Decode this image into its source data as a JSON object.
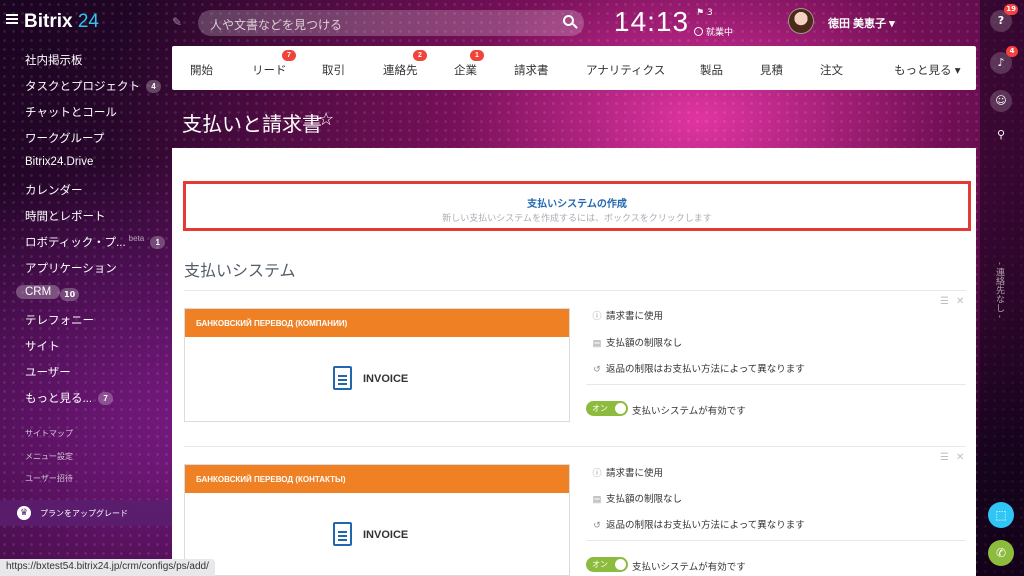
{
  "header": {
    "logo_name": "Bitrix",
    "logo_num": "24",
    "search_placeholder": "人や文書などを見つける",
    "clock": "14:13",
    "flag_count": "3",
    "work_status": "就業中",
    "user_name": "徳田 美恵子"
  },
  "sidebar": {
    "items": [
      {
        "label": "社内掲示板"
      },
      {
        "label": "タスクとプロジェクト",
        "badge": "4"
      },
      {
        "label": "チャットとコール"
      },
      {
        "label": "ワークグループ"
      },
      {
        "label": "Bitrix24.Drive"
      },
      {
        "label": "カレンダー"
      },
      {
        "label": "時間とレポート"
      },
      {
        "label": "ロボティック・プ...",
        "beta": "beta",
        "badge": "1"
      },
      {
        "label": "アプリケーション"
      },
      {
        "label": "CRM",
        "badge": "10"
      },
      {
        "label": "テレフォニー"
      },
      {
        "label": "サイト"
      },
      {
        "label": "ユーザー"
      },
      {
        "label": "もっと見る...",
        "badge": "7"
      }
    ],
    "links": [
      "サイトマップ",
      "メニュー設定",
      "ユーザー招待"
    ],
    "upgrade_label": "プランをアップグレード"
  },
  "rightbar": {
    "help_badge": "19",
    "notify_badge": "4",
    "vertical_text": "- 連絡先なし -"
  },
  "tabs": [
    {
      "label": "開始"
    },
    {
      "label": "リード",
      "badge": "7"
    },
    {
      "label": "取引"
    },
    {
      "label": "連絡先",
      "badge": "2"
    },
    {
      "label": "企業",
      "badge": "1"
    },
    {
      "label": "請求書"
    },
    {
      "label": "アナリティクス"
    },
    {
      "label": "製品"
    },
    {
      "label": "見積"
    },
    {
      "label": "注文"
    },
    {
      "label": "もっと見る"
    }
  ],
  "page": {
    "title": "支払いと請求書",
    "create_title": "支払いシステムの作成",
    "create_subtitle": "新しい支払いシステムを作成するには、ボックスをクリックします",
    "section_title": "支払いシステム"
  },
  "payment_systems": [
    {
      "name": "БАНКОВСКИЙ ПЕРЕВОД (КОМПАНИИ)",
      "invoice_label": "INVOICE",
      "features": [
        "請求書に使用",
        "支払額の制限なし",
        "返品の制限はお支払い方法によって異なります"
      ],
      "toggle_label": "オン",
      "status_text": "支払いシステムが有効です"
    },
    {
      "name": "БАНКОВСКИЙ ПЕРЕВОД (КОНТАКТЫ)",
      "invoice_label": "INVOICE",
      "features": [
        "請求書に使用",
        "支払額の制限なし",
        "返品の制限はお支払い方法によって異なります"
      ],
      "toggle_label": "オン",
      "status_text": "支払いシステムが有効です"
    }
  ],
  "status_url": "https://bxtest54.bitrix24.jp/crm/configs/ps/add/",
  "colors": {
    "accent_blue": "#2067b0",
    "card_header_orange": "#f08024",
    "highlight_red": "#e53935",
    "toggle_green": "#8dbb3e",
    "badge_red": "#f0443a"
  }
}
